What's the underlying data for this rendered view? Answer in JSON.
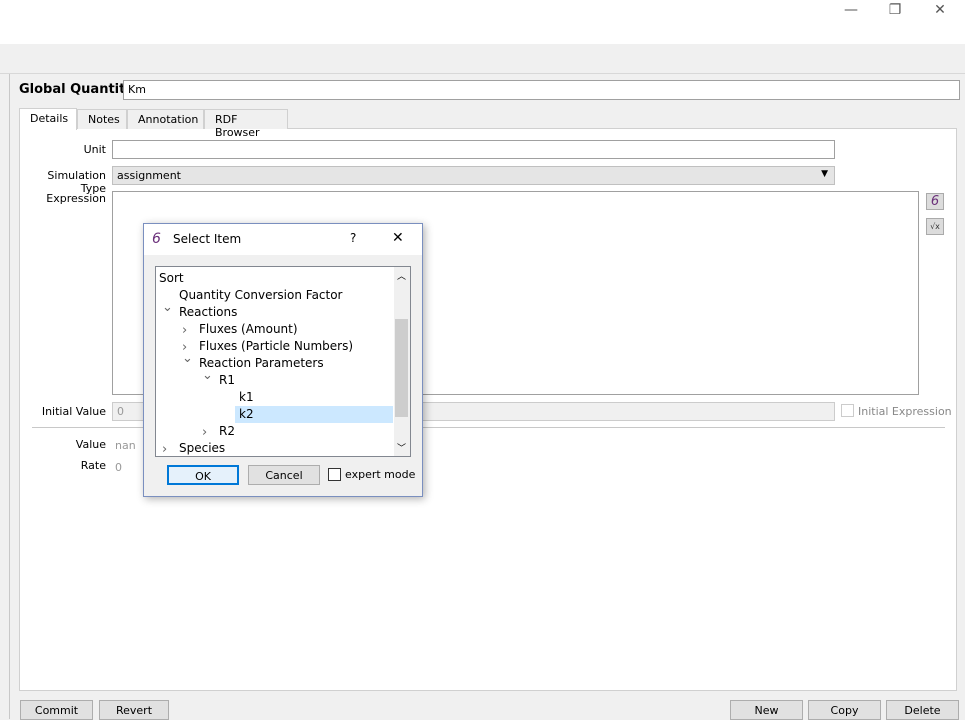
{
  "window": {
    "minimize": "—",
    "restore": "❐",
    "close": "✕"
  },
  "header": {
    "label": "Global Quantity",
    "value": "Km"
  },
  "tabs": [
    {
      "label": "Details"
    },
    {
      "label": "Notes"
    },
    {
      "label": "Annotation"
    },
    {
      "label": "RDF Browser"
    }
  ],
  "form": {
    "unit_label": "Unit",
    "unit_value": "",
    "sim_type_label": "Simulation Type",
    "sim_type_value": "assignment",
    "expression_label": "Expression",
    "initial_value_label": "Initial Value",
    "initial_value": "0",
    "initial_expression_label": "Initial Expression",
    "value_label": "Value",
    "value": "nan",
    "rate_label": "Rate",
    "rate": "0"
  },
  "buttons": {
    "commit": "Commit",
    "revert": "Revert",
    "new": "New",
    "copy": "Copy",
    "delete": "Delete"
  },
  "dialog": {
    "title": "Select Item",
    "help": "?",
    "close": "✕",
    "sort_header": "Sort",
    "tree": [
      {
        "label": "Quantity Conversion Factor",
        "level": 1,
        "state": "leaf"
      },
      {
        "label": "Reactions",
        "level": 1,
        "state": "expanded"
      },
      {
        "label": "Fluxes (Amount)",
        "level": 2,
        "state": "collapsed"
      },
      {
        "label": "Fluxes (Particle Numbers)",
        "level": 2,
        "state": "collapsed"
      },
      {
        "label": "Reaction Parameters",
        "level": 2,
        "state": "expanded"
      },
      {
        "label": "R1",
        "level": 3,
        "state": "expanded"
      },
      {
        "label": "k1",
        "level": 4,
        "state": "leaf"
      },
      {
        "label": "k2",
        "level": 4,
        "state": "leaf",
        "selected": true
      },
      {
        "label": "R2",
        "level": 3,
        "state": "collapsed"
      },
      {
        "label": "Species",
        "level": 1,
        "state": "collapsed"
      }
    ],
    "ok": "OK",
    "cancel": "Cancel",
    "expert_mode": "expert mode",
    "expert_mode_checked": false
  },
  "colors": {
    "selection": "#cce8ff",
    "focus": "#0078d7"
  }
}
